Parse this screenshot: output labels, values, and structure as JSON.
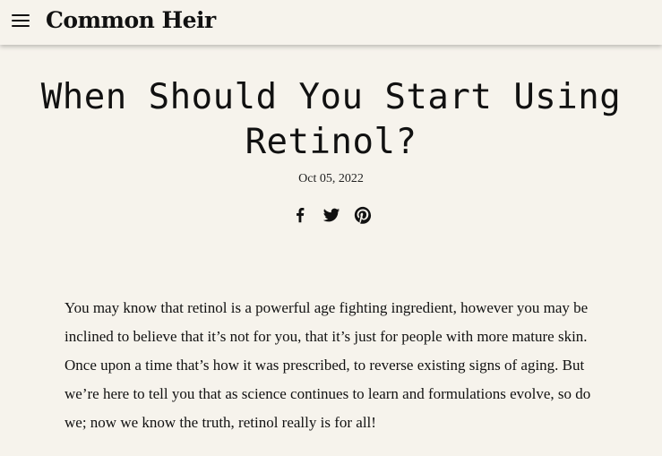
{
  "header": {
    "logo": "Common Heir",
    "menu_icon": "hamburger-menu-icon"
  },
  "article": {
    "title": "When Should You Start Using Retinol?",
    "date": "Oct 05, 2022",
    "share_icons": [
      "facebook-icon",
      "twitter-icon",
      "pinterest-icon"
    ],
    "paragraph": "You may know that retinol is a powerful age fighting ingredient, however you may be inclined to believe that it’s not for you, that it’s just for people with more mature skin. Once upon a time that’s how it was prescribed, to reverse existing signs of aging. But we’re here to tell you that as science continues to learn and formulations evolve, so do we; now we know the truth, retinol really is for all!"
  },
  "colors": {
    "background": "#f6f3ec",
    "text": "#111111"
  }
}
